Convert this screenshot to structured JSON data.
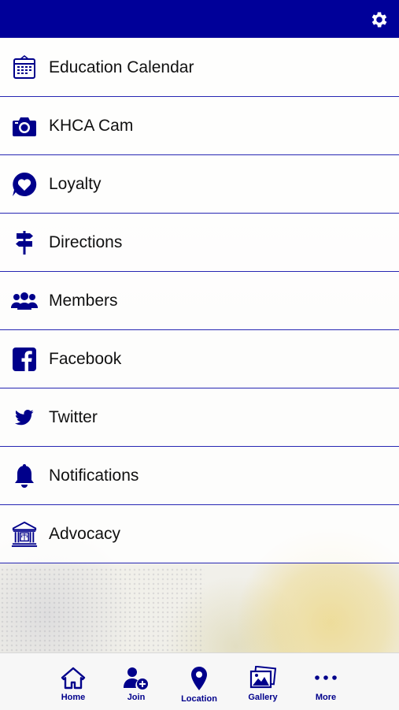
{
  "header": {
    "settings_icon": "gear-icon",
    "background": "#000099"
  },
  "menu": {
    "items": [
      {
        "label": "Education Calendar",
        "icon": "calendar-icon"
      },
      {
        "label": "KHCA Cam",
        "icon": "camera-icon"
      },
      {
        "label": "Loyalty",
        "icon": "heart-bubble-icon"
      },
      {
        "label": "Directions",
        "icon": "signpost-icon"
      },
      {
        "label": "Members",
        "icon": "users-icon"
      },
      {
        "label": "Facebook",
        "icon": "facebook-icon"
      },
      {
        "label": "Twitter",
        "icon": "twitter-icon"
      },
      {
        "label": "Notifications",
        "icon": "bell-icon"
      },
      {
        "label": "Advocacy",
        "icon": "courthouse-icon"
      }
    ]
  },
  "tabbar": {
    "tabs": [
      {
        "label": "Home",
        "icon": "home-icon"
      },
      {
        "label": "Join",
        "icon": "add-user-icon"
      },
      {
        "label": "Location",
        "icon": "map-pin-icon"
      },
      {
        "label": "Gallery",
        "icon": "gallery-icon"
      },
      {
        "label": "More",
        "icon": "more-dots-icon"
      }
    ]
  },
  "colors": {
    "brand": "#000099",
    "icon": "#00008b",
    "divider": "#2727b3"
  }
}
